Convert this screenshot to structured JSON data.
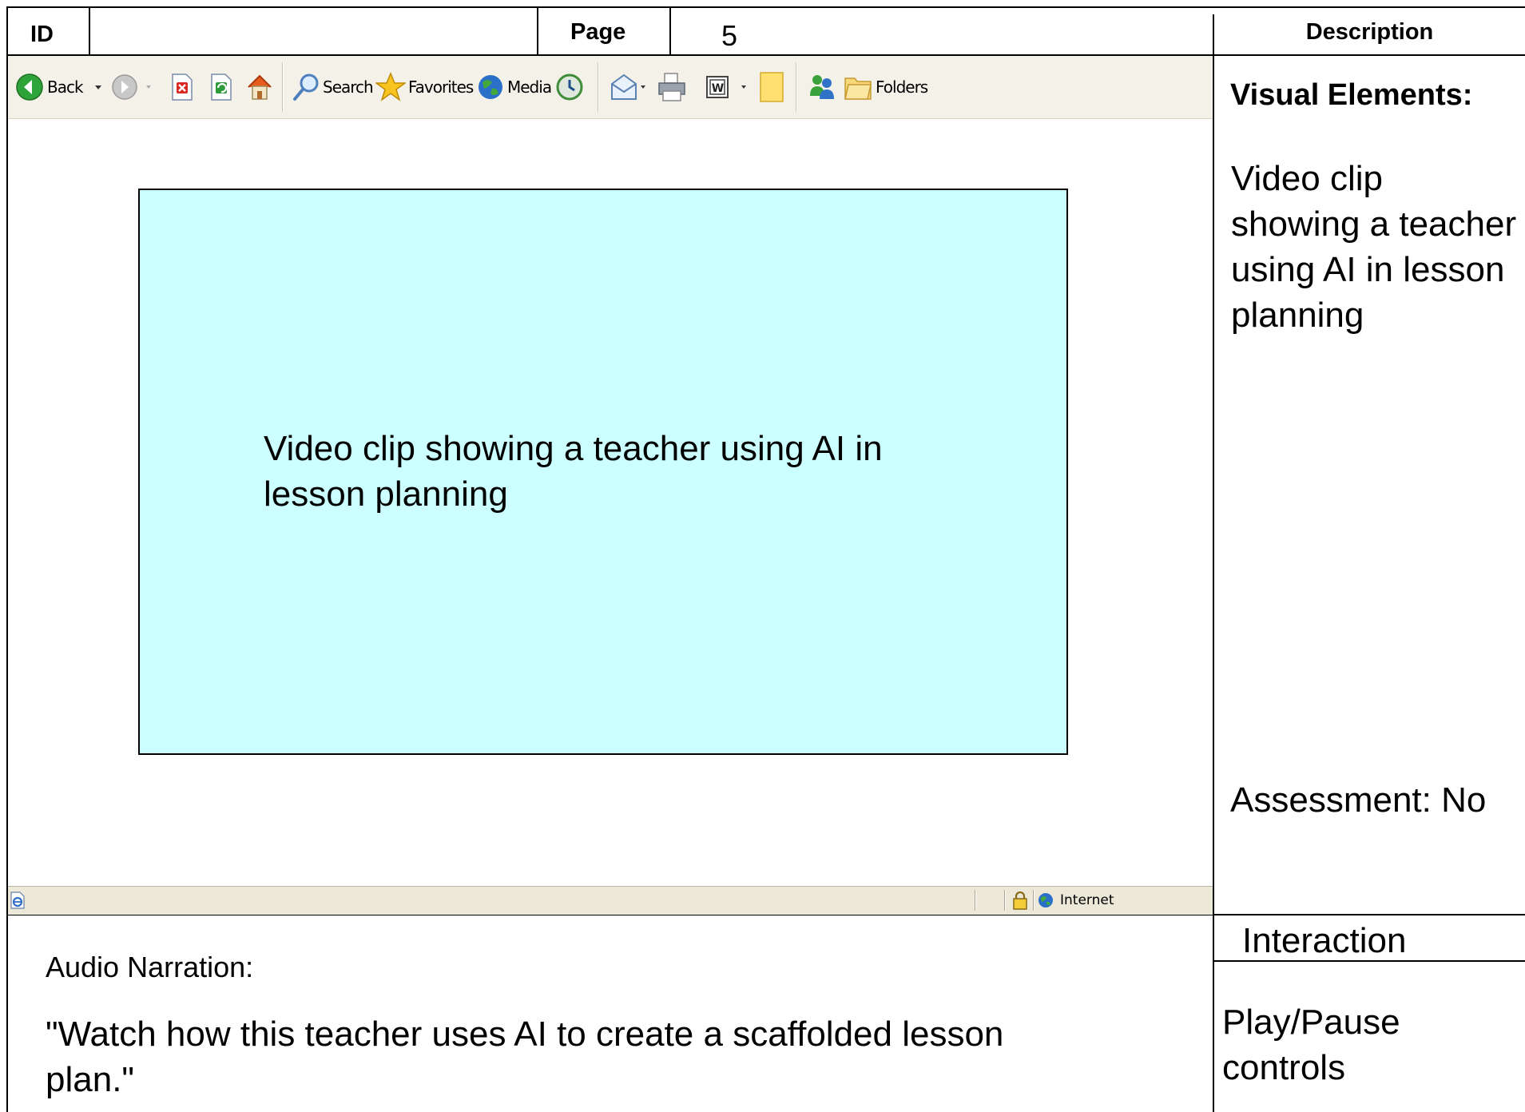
{
  "header": {
    "id_label": "ID",
    "id_value": "",
    "page_label": "Page",
    "page_value": "5",
    "description_label": "Description"
  },
  "browser": {
    "toolbar": {
      "back_label": "Back",
      "search_label": "Search",
      "favorites_label": "Favorites",
      "media_label": "Media",
      "folders_label": "Folders"
    },
    "video_placeholder_text": "Video clip showing a teacher using AI in lesson planning",
    "statusbar": {
      "zone_label": "Internet"
    }
  },
  "description": {
    "visual_elements_heading": "Visual Elements:",
    "visual_elements_text": "Video clip showing a teacher using AI in lesson planning",
    "assessment_text": "Assessment: No",
    "interaction_heading": "Interaction",
    "interaction_text": "Play/Pause controls"
  },
  "narration": {
    "label": "Audio Narration:",
    "text": "\"Watch how this teacher uses AI to create a scaffolded lesson plan.\""
  },
  "colors": {
    "video_background": "#ccffff",
    "toolbar_background": "#f4f2e8",
    "statusbar_background": "#ece9d8"
  }
}
